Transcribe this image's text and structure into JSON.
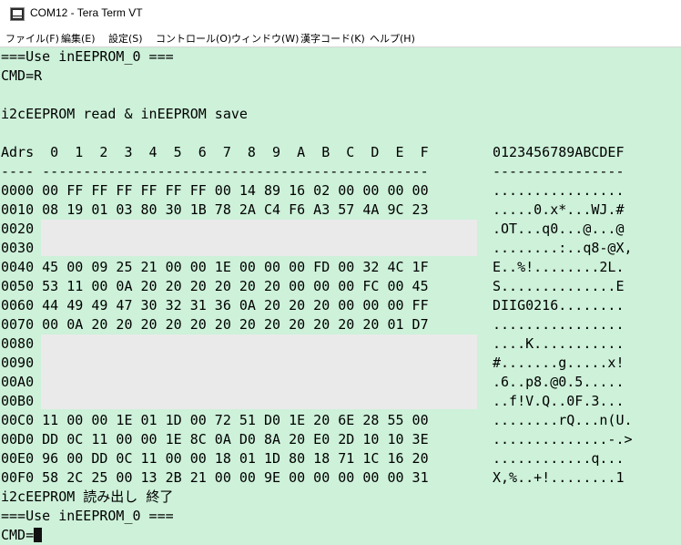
{
  "window": {
    "title": "COM12 - Tera Term VT",
    "app_icon": "terminal-icon"
  },
  "menu": [
    {
      "id": "file",
      "label": "ファイル(F)"
    },
    {
      "id": "edit",
      "label": "編集(E)"
    },
    {
      "id": "setup",
      "label": "設定(S)"
    },
    {
      "id": "control",
      "label": "コントロール(O)"
    },
    {
      "id": "window",
      "label": "ウィンドウ(W)"
    },
    {
      "id": "kanji",
      "label": "漢字コード(K)"
    },
    {
      "id": "help",
      "label": "ヘルプ(H)"
    }
  ],
  "terminal": {
    "header_lines": [
      "===Use inEEPROM_0 ===",
      "CMD=R",
      "",
      "i2cEEPROM read & inEEPROM save",
      ""
    ],
    "hex_header": "Adrs  0  1  2  3  4  5  6  7  8  9  A  B  C  D  E  F",
    "hex_divider": "---- -----------------------------------------------",
    "ascii_header": "0123456789ABCDEF",
    "ascii_divider": "----------------",
    "rows": [
      {
        "addr": "0000",
        "bytes": "00 FF FF FF FF FF FF 00 14 89 16 02 00 00 00 00",
        "ascii": "................"
      },
      {
        "addr": "0010",
        "bytes": "08 19 01 03 80 30 1B 78 2A C4 F6 A3 57 4A 9C 23",
        "ascii": ".....0.x*...WJ.#"
      },
      {
        "addr": "0020",
        "bytes": "",
        "ascii": ".OT...q0...@...@"
      },
      {
        "addr": "0030",
        "bytes": "",
        "ascii": "........:..q8-@X,"
      },
      {
        "addr": "0040",
        "bytes": "45 00 09 25 21 00 00 1E 00 00 00 FD 00 32 4C 1F",
        "ascii": "E..%!........2L."
      },
      {
        "addr": "0050",
        "bytes": "53 11 00 0A 20 20 20 20 20 20 00 00 00 FC 00 45",
        "ascii": "S..............E"
      },
      {
        "addr": "0060",
        "bytes": "44 49 49 47 30 32 31 36 0A 20 20 20 00 00 00 FF",
        "ascii": "DIIG0216........"
      },
      {
        "addr": "0070",
        "bytes": "00 0A 20 20 20 20 20 20 20 20 20 20 20 20 01 D7",
        "ascii": "................"
      },
      {
        "addr": "0080",
        "bytes": "",
        "ascii": "....K..........."
      },
      {
        "addr": "0090",
        "bytes": "",
        "ascii": "#.......g.....x!"
      },
      {
        "addr": "00A0",
        "bytes": "",
        "ascii": ".6..p8.@0.5....."
      },
      {
        "addr": "00B0",
        "bytes": "",
        "ascii": "..f!V.Q..0F.3..."
      },
      {
        "addr": "00C0",
        "bytes": "11 00 00 1E 01 1D 00 72 51 D0 1E 20 6E 28 55 00",
        "ascii": "........rQ...n(U."
      },
      {
        "addr": "00D0",
        "bytes": "DD 0C 11 00 00 1E 8C 0A D0 8A 20 E0 2D 10 10 3E",
        "ascii": "..............-.>"
      },
      {
        "addr": "00E0",
        "bytes": "96 00 DD 0C 11 00 00 18 01 1D 80 18 71 1C 16 20",
        "ascii": "............q..."
      },
      {
        "addr": "00F0",
        "bytes": "58 2C 25 00 13 2B 21 00 00 9E 00 00 00 00 00 31",
        "ascii": "X,%..+!........1"
      }
    ],
    "footer_lines": [
      "i2cEEPROM 読み出し 終了",
      "===Use inEEPROM_0 ===",
      "CMD="
    ],
    "highlight_color": "#eaeaea",
    "background_color": "#cdf1d9"
  }
}
